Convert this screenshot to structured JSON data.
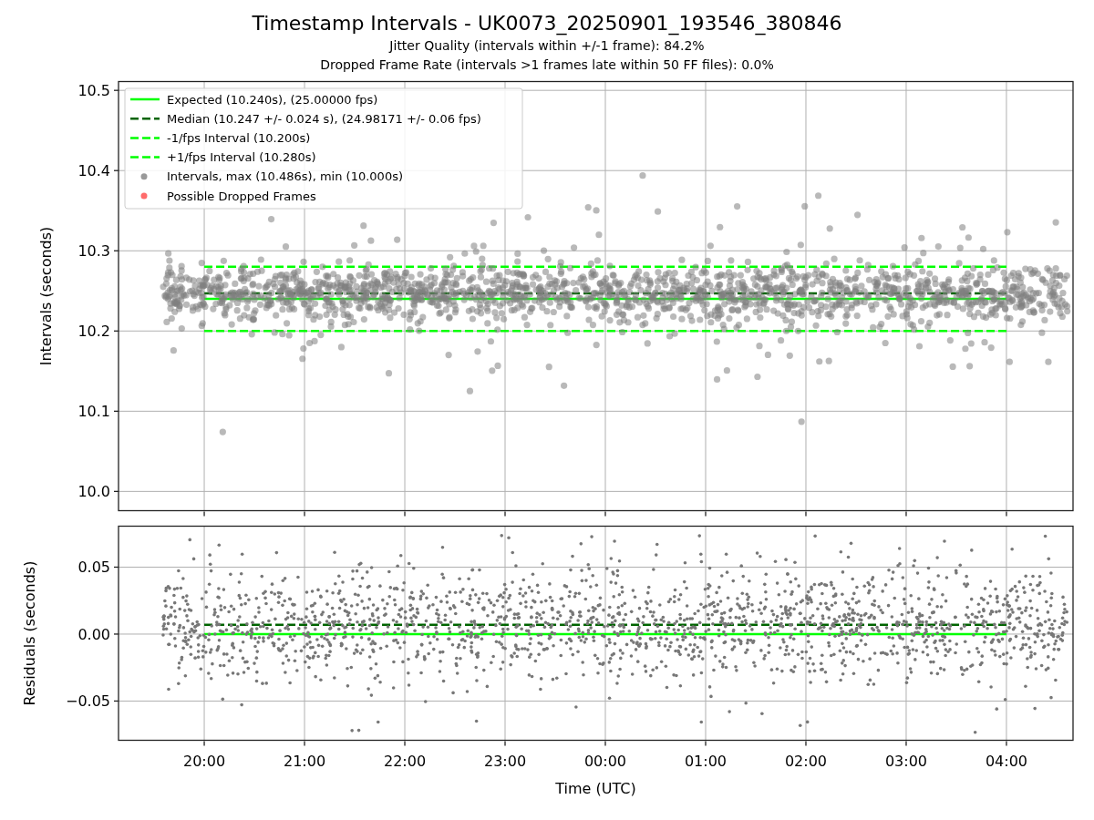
{
  "title": "Timestamp Intervals - UK0073_20250901_193546_380846",
  "subtitles": [
    "Jitter Quality (intervals within +/-1 frame): 84.2%",
    "Dropped Frame Rate (intervals >1 frames late within 50 FF files): 0.0%"
  ],
  "intervals_plot": {
    "chart_data": {
      "type": "line",
      "ylabel": "Intervals (seconds)",
      "grid": true,
      "legend": "upper left",
      "categories": [
        null,
        null,
        null,
        null,
        null,
        null,
        null,
        null,
        null
      ],
      "series": [
        {
          "name": "Expected (10.240s), (25.00000 fps)",
          "color": "#00ff00",
          "line_style": "solid",
          "values": [
            10.24,
            10.24,
            10.24,
            10.24,
            10.24,
            10.24,
            10.24,
            10.24,
            10.24
          ]
        },
        {
          "name": "Median (10.247 +/- 0.024 s), (24.98171 +/- 0.06 fps)",
          "color": "#006400",
          "line_style": "dashed",
          "values": [
            10.247,
            10.247,
            10.247,
            10.247,
            10.247,
            10.247,
            10.247,
            10.247,
            10.247
          ]
        },
        {
          "name": "-1/fps Interval (10.200s)",
          "color": "#00ff00",
          "line_style": "dashed",
          "values": [
            10.2,
            10.2,
            10.2,
            10.2,
            10.2,
            10.2,
            10.2,
            10.2,
            10.2
          ]
        },
        {
          "name": "+1/fps Interval (10.280s)",
          "color": "#00ff00",
          "line_style": "dashed",
          "values": [
            10.28,
            10.28,
            10.28,
            10.28,
            10.28,
            10.28,
            10.28,
            10.28,
            10.28
          ]
        }
      ],
      "ylim": [
        9.976,
        10.511
      ],
      "yticks": [
        {
          "value": 10.0,
          "label": "10.0"
        },
        {
          "value": 10.1,
          "label": "10.1"
        },
        {
          "value": 10.2,
          "label": "10.2"
        },
        {
          "value": 10.3,
          "label": "10.3"
        },
        {
          "value": 10.4,
          "label": "10.4"
        },
        {
          "value": 10.5,
          "label": "10.5"
        }
      ]
    },
    "point_legend": [
      {
        "label": "Intervals, max (10.486s), min (10.000s)",
        "color": "#999999"
      },
      {
        "label": "Possible Dropped Frames",
        "color": "#ff6b6b"
      }
    ]
  },
  "residuals_plot": {
    "chart_data": {
      "type": "line",
      "xlabel": "Time (UTC)",
      "ylabel": "Residuals (seconds)",
      "grid": true,
      "categories": [
        "20:00",
        "21:00",
        "22:00",
        "23:00",
        "00:00",
        "01:00",
        "02:00",
        "03:00",
        "04:00"
      ],
      "series": [
        {
          "color": "#006400",
          "line_style": "dashed",
          "values": [
            0.007,
            0.007,
            0.007,
            0.007,
            0.007,
            0.007,
            0.007,
            0.007,
            0.007
          ]
        },
        {
          "color": "#00ff00",
          "line_style": "solid",
          "values": [
            0,
            0,
            0,
            0,
            0,
            0,
            0,
            0,
            0
          ]
        }
      ],
      "ylim": [
        -0.0793,
        0.0806
      ],
      "yticks": [
        {
          "value": -0.05,
          "label": "−0.05"
        },
        {
          "value": 0,
          "label": "0.00"
        },
        {
          "value": 0.05,
          "label": "0.05"
        }
      ]
    }
  }
}
